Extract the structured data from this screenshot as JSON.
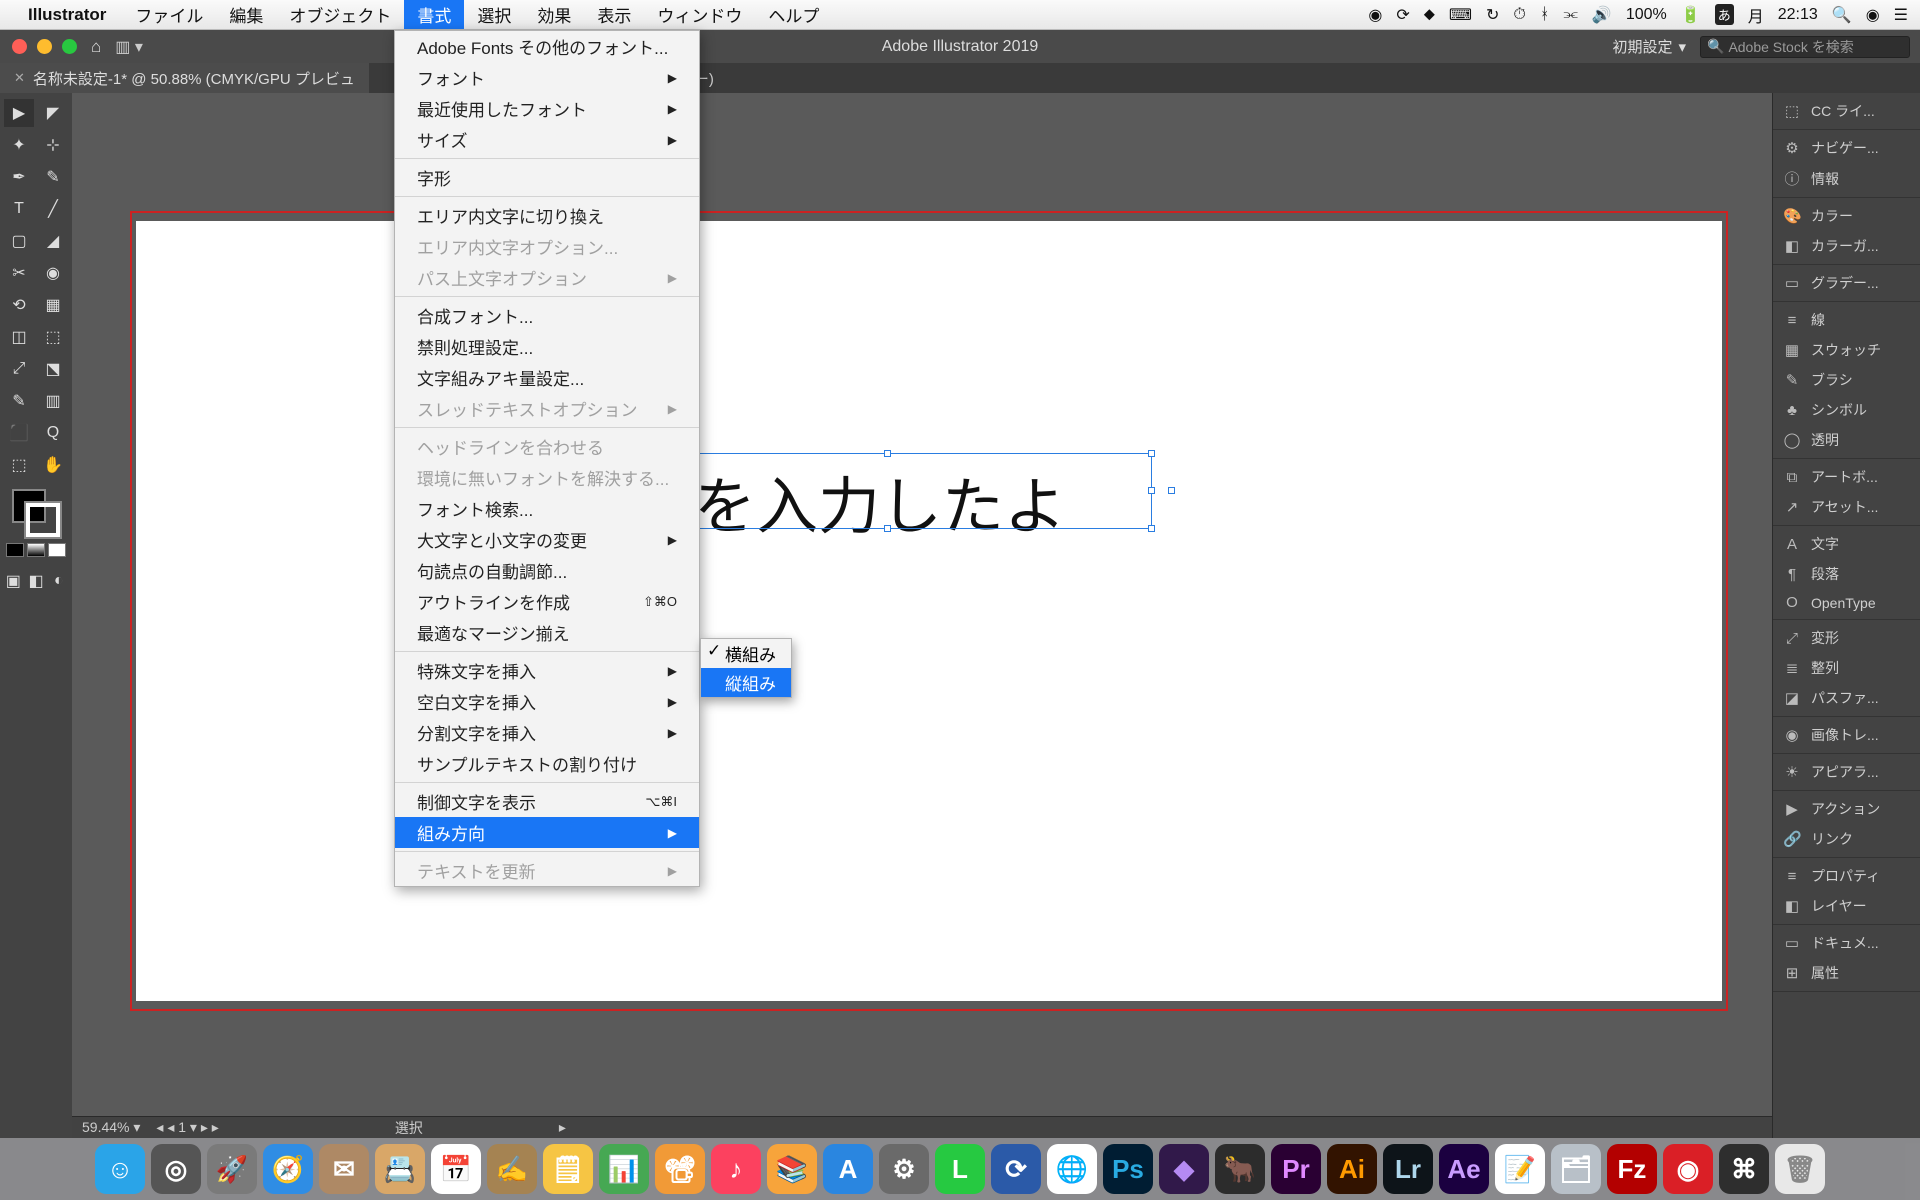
{
  "menubar": {
    "app": "Illustrator",
    "items": [
      "ファイル",
      "編集",
      "オブジェクト",
      "書式",
      "選択",
      "効果",
      "表示",
      "ウィンドウ",
      "ヘルプ"
    ],
    "active_idx": 3,
    "right": {
      "battery": "100%",
      "day": "月",
      "time": "22:13"
    }
  },
  "appbar": {
    "title": "Adobe Illustrator 2019",
    "preset": "初期設定",
    "stock_placeholder": "Adobe Stock を検索"
  },
  "tab": {
    "label": "名称未設定-1* @ 50.88% (CMYK/GPU プレビュ",
    "trail": "レビュー)"
  },
  "canvas": {
    "visible_text": "字を入力したよ"
  },
  "dropdown": {
    "items": [
      {
        "label": "Adobe Fonts その他のフォント...",
        "type": "n"
      },
      {
        "label": "フォント",
        "type": "arr"
      },
      {
        "label": "最近使用したフォント",
        "type": "arr"
      },
      {
        "label": "サイズ",
        "type": "arr"
      },
      {
        "type": "sep"
      },
      {
        "label": "字形",
        "type": "n"
      },
      {
        "type": "sep"
      },
      {
        "label": "エリア内文字に切り換え",
        "type": "n"
      },
      {
        "label": "エリア内文字オプション...",
        "type": "dis"
      },
      {
        "label": "パス上文字オプション",
        "type": "dis",
        "arr": true
      },
      {
        "type": "sep"
      },
      {
        "label": "合成フォント...",
        "type": "n"
      },
      {
        "label": "禁則処理設定...",
        "type": "n"
      },
      {
        "label": "文字組みアキ量設定...",
        "type": "n"
      },
      {
        "label": "スレッドテキストオプション",
        "type": "dis",
        "arr": true
      },
      {
        "type": "sep"
      },
      {
        "label": "ヘッドラインを合わせる",
        "type": "dis"
      },
      {
        "label": "環境に無いフォントを解決する...",
        "type": "dis"
      },
      {
        "label": "フォント検索...",
        "type": "n"
      },
      {
        "label": "大文字と小文字の変更",
        "type": "arr"
      },
      {
        "label": "句読点の自動調節...",
        "type": "n"
      },
      {
        "label": "アウトラインを作成",
        "type": "n",
        "sc": "⇧⌘O"
      },
      {
        "label": "最適なマージン揃え",
        "type": "n"
      },
      {
        "type": "sep"
      },
      {
        "label": "特殊文字を挿入",
        "type": "arr"
      },
      {
        "label": "空白文字を挿入",
        "type": "arr"
      },
      {
        "label": "分割文字を挿入",
        "type": "arr"
      },
      {
        "label": "サンプルテキストの割り付け",
        "type": "n"
      },
      {
        "type": "sep"
      },
      {
        "label": "制御文字を表示",
        "type": "n",
        "sc": "⌥⌘I"
      },
      {
        "label": "組み方向",
        "type": "arr",
        "hl": true
      },
      {
        "type": "sep"
      },
      {
        "label": "テキストを更新",
        "type": "dis",
        "arr": true
      }
    ]
  },
  "submenu": {
    "items": [
      {
        "label": "横組み",
        "checked": true
      },
      {
        "label": "縦組み",
        "hl": true
      }
    ]
  },
  "panels": [
    {
      "group": [
        {
          "ic": "⬚",
          "label": "CC ライ..."
        }
      ]
    },
    {
      "group": [
        {
          "ic": "⚙",
          "label": "ナビゲー..."
        },
        {
          "ic": "ⓘ",
          "label": "情報"
        }
      ]
    },
    {
      "group": [
        {
          "ic": "🎨",
          "label": "カラー"
        },
        {
          "ic": "◧",
          "label": "カラーガ..."
        }
      ]
    },
    {
      "group": [
        {
          "ic": "▭",
          "label": "グラデー..."
        }
      ]
    },
    {
      "group": [
        {
          "ic": "≡",
          "label": "線"
        },
        {
          "ic": "▦",
          "label": "スウォッチ"
        },
        {
          "ic": "✎",
          "label": "ブラシ"
        },
        {
          "ic": "♣",
          "label": "シンボル"
        },
        {
          "ic": "◯",
          "label": "透明"
        }
      ]
    },
    {
      "group": [
        {
          "ic": "⧉",
          "label": "アートボ..."
        },
        {
          "ic": "↗",
          "label": "アセット..."
        }
      ]
    },
    {
      "group": [
        {
          "ic": "A",
          "label": "文字"
        },
        {
          "ic": "¶",
          "label": "段落"
        },
        {
          "ic": "O",
          "label": "OpenType"
        }
      ]
    },
    {
      "group": [
        {
          "ic": "⤢",
          "label": "変形"
        },
        {
          "ic": "≣",
          "label": "整列"
        },
        {
          "ic": "◪",
          "label": "パスファ..."
        }
      ]
    },
    {
      "group": [
        {
          "ic": "◉",
          "label": "画像トレ..."
        }
      ]
    },
    {
      "group": [
        {
          "ic": "☀",
          "label": "アピアラ..."
        }
      ]
    },
    {
      "group": [
        {
          "ic": "▶",
          "label": "アクション"
        },
        {
          "ic": "🔗",
          "label": "リンク"
        }
      ]
    },
    {
      "group": [
        {
          "ic": "≡",
          "label": "プロパティ"
        },
        {
          "ic": "◧",
          "label": "レイヤー"
        }
      ]
    },
    {
      "group": [
        {
          "ic": "▭",
          "label": "ドキュメ..."
        },
        {
          "ic": "⊞",
          "label": "属性"
        }
      ]
    }
  ],
  "status": {
    "zoom": "59.44%",
    "page": "1",
    "mode": "選択"
  },
  "dock": [
    {
      "bg": "#2aa4e8",
      "t": "☺"
    },
    {
      "bg": "#555",
      "t": "◎"
    },
    {
      "bg": "#7a7a7a",
      "t": "🚀"
    },
    {
      "bg": "#2f8de4",
      "t": "🧭"
    },
    {
      "bg": "#ae8965",
      "t": "✉"
    },
    {
      "bg": "#d9a768",
      "t": "📇"
    },
    {
      "bg": "#fff",
      "t": "📅",
      "c": "#cc2b2b"
    },
    {
      "bg": "#a58352",
      "t": "✍"
    },
    {
      "bg": "#f6c544",
      "t": "🗒"
    },
    {
      "bg": "#46a853",
      "t": "📊"
    },
    {
      "bg": "#f19a37",
      "t": "📽"
    },
    {
      "bg": "#fc415f",
      "t": "♪"
    },
    {
      "bg": "#f7a43b",
      "t": "📚"
    },
    {
      "bg": "#2a86e0",
      "t": "A"
    },
    {
      "bg": "#6a6a6a",
      "t": "⚙"
    },
    {
      "bg": "#26c941",
      "t": "L"
    },
    {
      "bg": "#2b5aa8",
      "t": "⟳"
    },
    {
      "bg": "#fff",
      "t": "🌐",
      "c": "#e94335"
    },
    {
      "bg": "#001d33",
      "t": "Ps",
      "c": "#29abe2"
    },
    {
      "bg": "#31194a",
      "t": "◆",
      "c": "#b58af3"
    },
    {
      "bg": "#2c2c2c",
      "t": "🐂"
    },
    {
      "bg": "#2a0033",
      "t": "Pr",
      "c": "#e089ff"
    },
    {
      "bg": "#321300",
      "t": "Ai",
      "c": "#ff9a00"
    },
    {
      "bg": "#0d1419",
      "t": "Lr",
      "c": "#aed7ec"
    },
    {
      "bg": "#1b0040",
      "t": "Ae",
      "c": "#c99cff"
    },
    {
      "bg": "#fff",
      "t": "📝",
      "c": "#555"
    },
    {
      "bg": "#b8c0c8",
      "t": "🗂"
    },
    {
      "bg": "#b30000",
      "t": "Fz"
    },
    {
      "bg": "#da1f26",
      "t": "◉"
    },
    {
      "bg": "#2e2e2e",
      "t": "⌘"
    },
    {
      "bg": "#e8e8e8",
      "t": "🗑",
      "c": "#888"
    }
  ]
}
